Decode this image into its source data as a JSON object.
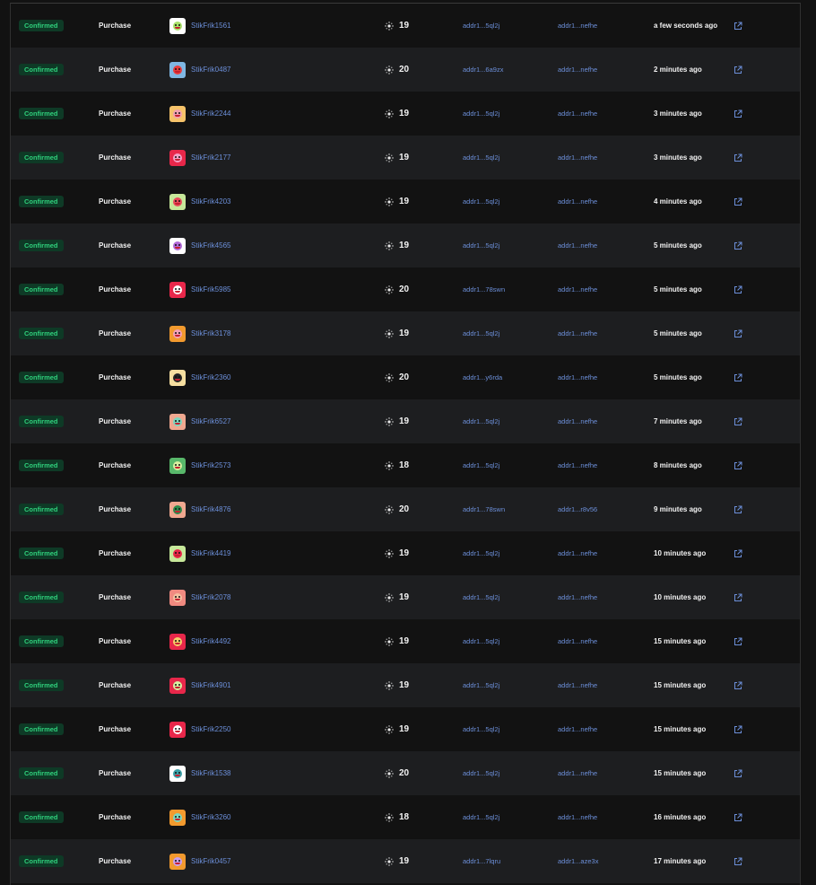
{
  "colors": {
    "background": "#121212",
    "row_alt": "#1d1e20",
    "badge_bg": "#0e3a26",
    "badge_text": "#2fd07c",
    "link": "#6c8fd9"
  },
  "icons": {
    "price": "ada-sun-icon",
    "link": "external-link-icon"
  },
  "rows": [
    {
      "status": "Confirmed",
      "type": "Purchase",
      "item": "StikFrik1561",
      "avatar_bg": "#ffffff",
      "avatar_face": "#a8e06a",
      "price": "19",
      "from": "addr1...5ql2j",
      "to": "addr1...nefhe",
      "time": "a few seconds ago"
    },
    {
      "status": "Confirmed",
      "type": "Purchase",
      "item": "StikFrik0487",
      "avatar_bg": "#7fb7e3",
      "avatar_face": "#e83b3b",
      "price": "20",
      "from": "addr1...6a9zx",
      "to": "addr1...nefhe",
      "time": "2 minutes ago"
    },
    {
      "status": "Confirmed",
      "type": "Purchase",
      "item": "StikFrik2244",
      "avatar_bg": "#f6c36a",
      "avatar_face": "#f2a0b0",
      "price": "19",
      "from": "addr1...5ql2j",
      "to": "addr1...nefhe",
      "time": "3 minutes ago"
    },
    {
      "status": "Confirmed",
      "type": "Purchase",
      "item": "StikFrik2177",
      "avatar_bg": "#e8274a",
      "avatar_face": "#f4a0c8",
      "price": "19",
      "from": "addr1...5ql2j",
      "to": "addr1...nefhe",
      "time": "3 minutes ago"
    },
    {
      "status": "Confirmed",
      "type": "Purchase",
      "item": "StikFrik4203",
      "avatar_bg": "#c7e89a",
      "avatar_face": "#e84a5a",
      "price": "19",
      "from": "addr1...5ql2j",
      "to": "addr1...nefhe",
      "time": "4 minutes ago"
    },
    {
      "status": "Confirmed",
      "type": "Purchase",
      "item": "StikFrik4565",
      "avatar_bg": "#ffffff",
      "avatar_face": "#b06ad8",
      "price": "19",
      "from": "addr1...5ql2j",
      "to": "addr1...nefhe",
      "time": "5 minutes ago"
    },
    {
      "status": "Confirmed",
      "type": "Purchase",
      "item": "StikFrik5985",
      "avatar_bg": "#e8274a",
      "avatar_face": "#ffffff",
      "price": "20",
      "from": "addr1...78swn",
      "to": "addr1...nefhe",
      "time": "5 minutes ago"
    },
    {
      "status": "Confirmed",
      "type": "Purchase",
      "item": "StikFrik3178",
      "avatar_bg": "#f29a2e",
      "avatar_face": "#f4a0b8",
      "price": "19",
      "from": "addr1...5ql2j",
      "to": "addr1...nefhe",
      "time": "5 minutes ago"
    },
    {
      "status": "Confirmed",
      "type": "Purchase",
      "item": "StikFrik2360",
      "avatar_bg": "#f6dfa0",
      "avatar_face": "#222222",
      "price": "20",
      "from": "addr1...y6rda",
      "to": "addr1...nefhe",
      "time": "5 minutes ago"
    },
    {
      "status": "Confirmed",
      "type": "Purchase",
      "item": "StikFrik6527",
      "avatar_bg": "#f0a890",
      "avatar_face": "#7ad8c0",
      "price": "19",
      "from": "addr1...5ql2j",
      "to": "addr1...nefhe",
      "time": "7 minutes ago"
    },
    {
      "status": "Confirmed",
      "type": "Purchase",
      "item": "StikFrik2573",
      "avatar_bg": "#58b86a",
      "avatar_face": "#d8f0a0",
      "price": "18",
      "from": "addr1...5ql2j",
      "to": "addr1...nefhe",
      "time": "8 minutes ago"
    },
    {
      "status": "Confirmed",
      "type": "Purchase",
      "item": "StikFrik4876",
      "avatar_bg": "#f0a890",
      "avatar_face": "#2a8a4a",
      "price": "20",
      "from": "addr1...78swn",
      "to": "addr1...r8v56",
      "time": "9 minutes ago"
    },
    {
      "status": "Confirmed",
      "type": "Purchase",
      "item": "StikFrik4419",
      "avatar_bg": "#c7e89a",
      "avatar_face": "#e8274a",
      "price": "19",
      "from": "addr1...5ql2j",
      "to": "addr1...nefhe",
      "time": "10 minutes ago"
    },
    {
      "status": "Confirmed",
      "type": "Purchase",
      "item": "StikFrik2078",
      "avatar_bg": "#f08a80",
      "avatar_face": "#f4c0a0",
      "price": "19",
      "from": "addr1...5ql2j",
      "to": "addr1...nefhe",
      "time": "10 minutes ago"
    },
    {
      "status": "Confirmed",
      "type": "Purchase",
      "item": "StikFrik4492",
      "avatar_bg": "#e8274a",
      "avatar_face": "#f6d06a",
      "price": "19",
      "from": "addr1...5ql2j",
      "to": "addr1...nefhe",
      "time": "15 minutes ago"
    },
    {
      "status": "Confirmed",
      "type": "Purchase",
      "item": "StikFrik4901",
      "avatar_bg": "#e8274a",
      "avatar_face": "#d8f0a0",
      "price": "19",
      "from": "addr1...5ql2j",
      "to": "addr1...nefhe",
      "time": "15 minutes ago"
    },
    {
      "status": "Confirmed",
      "type": "Purchase",
      "item": "StikFrik2250",
      "avatar_bg": "#e8274a",
      "avatar_face": "#ffffff",
      "price": "19",
      "from": "addr1...5ql2j",
      "to": "addr1...nefhe",
      "time": "15 minutes ago"
    },
    {
      "status": "Confirmed",
      "type": "Purchase",
      "item": "StikFrik1538",
      "avatar_bg": "#ffffff",
      "avatar_face": "#3aa0a8",
      "price": "20",
      "from": "addr1...5ql2j",
      "to": "addr1...nefhe",
      "time": "15 minutes ago"
    },
    {
      "status": "Confirmed",
      "type": "Purchase",
      "item": "StikFrik3260",
      "avatar_bg": "#f29a2e",
      "avatar_face": "#7ad8c0",
      "price": "18",
      "from": "addr1...5ql2j",
      "to": "addr1...nefhe",
      "time": "16 minutes ago"
    },
    {
      "status": "Confirmed",
      "type": "Purchase",
      "item": "StikFrik0457",
      "avatar_bg": "#f29a2e",
      "avatar_face": "#c8a0f0",
      "price": "19",
      "from": "addr1...7lqru",
      "to": "addr1...aze3x",
      "time": "17 minutes ago"
    }
  ]
}
